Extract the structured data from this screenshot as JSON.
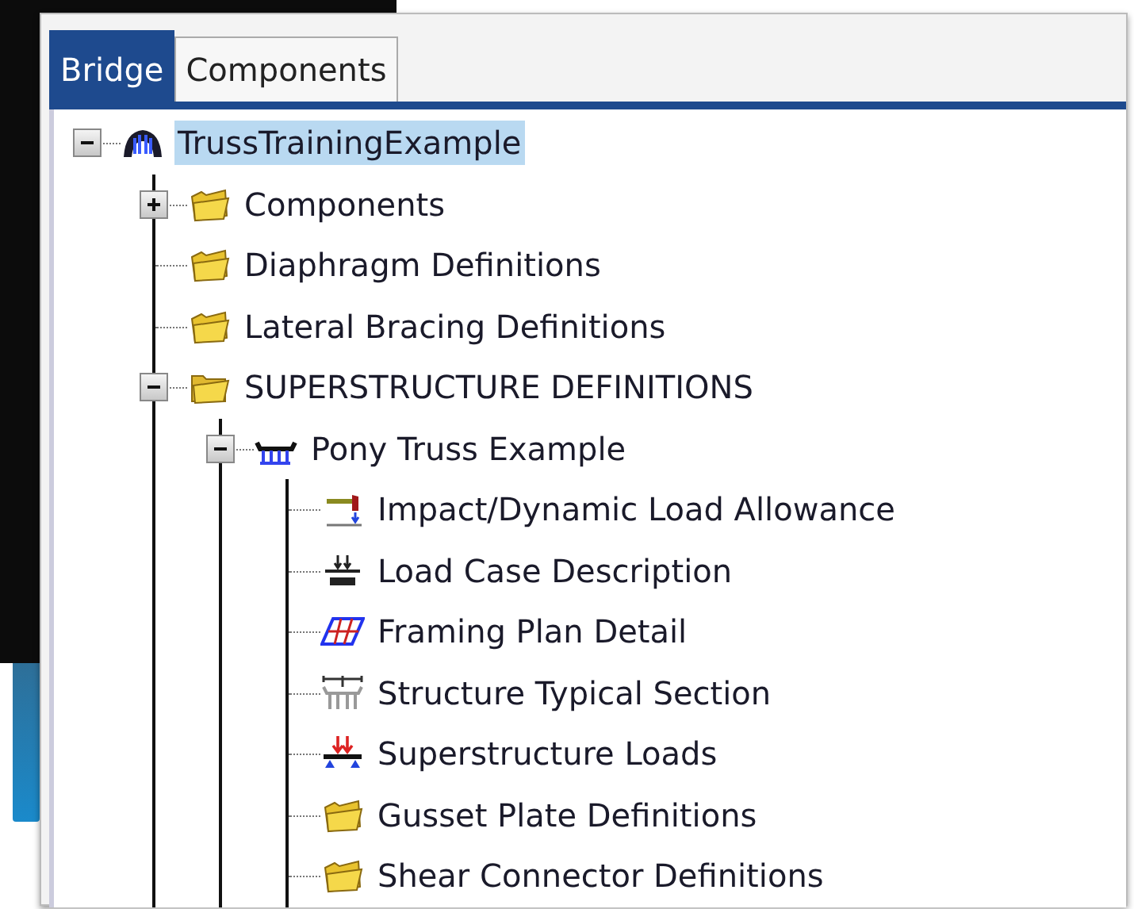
{
  "tabs": [
    {
      "label": "Bridge",
      "selected": true
    },
    {
      "label": "Components",
      "selected": false
    }
  ],
  "tree": {
    "items": [
      {
        "label": "TrussTrainingExample",
        "kind": "bridge",
        "selected": true,
        "expanded": true,
        "children": [
          {
            "label": "Components",
            "kind": "folder",
            "selected": false,
            "expanded": false
          },
          {
            "label": "Diaphragm Definitions",
            "kind": "folder",
            "selected": false
          },
          {
            "label": "Lateral Bracing Definitions",
            "kind": "folder",
            "selected": false
          },
          {
            "label": "SUPERSTRUCTURE DEFINITIONS",
            "kind": "folder",
            "selected": false,
            "expanded": true,
            "children": [
              {
                "label": "Pony Truss Example",
                "kind": "truss",
                "selected": false,
                "expanded": true,
                "children": [
                  {
                    "label": "Impact/Dynamic Load Allowance",
                    "kind": "impact",
                    "selected": false
                  },
                  {
                    "label": "Load Case Description",
                    "kind": "load-case",
                    "selected": false
                  },
                  {
                    "label": "Framing Plan Detail",
                    "kind": "framing",
                    "selected": false
                  },
                  {
                    "label": "Structure Typical Section",
                    "kind": "section",
                    "selected": false
                  },
                  {
                    "label": "Superstructure Loads",
                    "kind": "loads",
                    "selected": false
                  },
                  {
                    "label": "Gusset Plate Definitions",
                    "kind": "folder",
                    "selected": false
                  },
                  {
                    "label": "Shear Connector Definitions",
                    "kind": "folder",
                    "selected": false
                  }
                ]
              }
            ]
          }
        ]
      }
    ]
  }
}
